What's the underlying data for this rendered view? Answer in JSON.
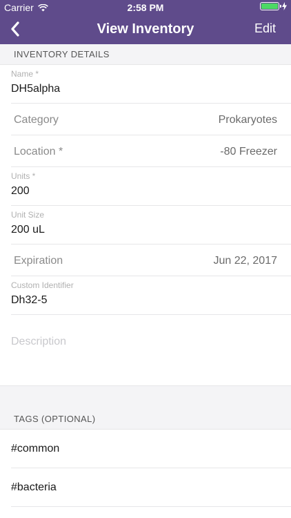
{
  "status_bar": {
    "carrier": "Carrier",
    "time": "2:58 PM",
    "battery_level": 1.0
  },
  "navbar": {
    "title": "View Inventory",
    "edit_label": "Edit",
    "back_icon": "chevron-left-icon"
  },
  "details": {
    "header": "INVENTORY DETAILS",
    "name": {
      "label": "Name *",
      "value": "DH5alpha"
    },
    "category": {
      "label": "Category",
      "value": "Prokaryotes"
    },
    "location": {
      "label": "Location *",
      "value": "-80 Freezer"
    },
    "units": {
      "label": "Units *",
      "value": "200"
    },
    "unit_size": {
      "label": "Unit Size",
      "value": "200 uL"
    },
    "expiration": {
      "label": "Expiration",
      "value": "Jun 22, 2017"
    },
    "custom_identifier": {
      "label": "Custom Identifier",
      "value": "Dh32-5"
    },
    "description": {
      "placeholder": "Description"
    }
  },
  "tags": {
    "header": "TAGS (OPTIONAL)",
    "items": [
      "#common",
      "#bacteria"
    ]
  },
  "colors": {
    "header_bg": "#5f4b8b",
    "battery_fill": "#4cd964"
  }
}
